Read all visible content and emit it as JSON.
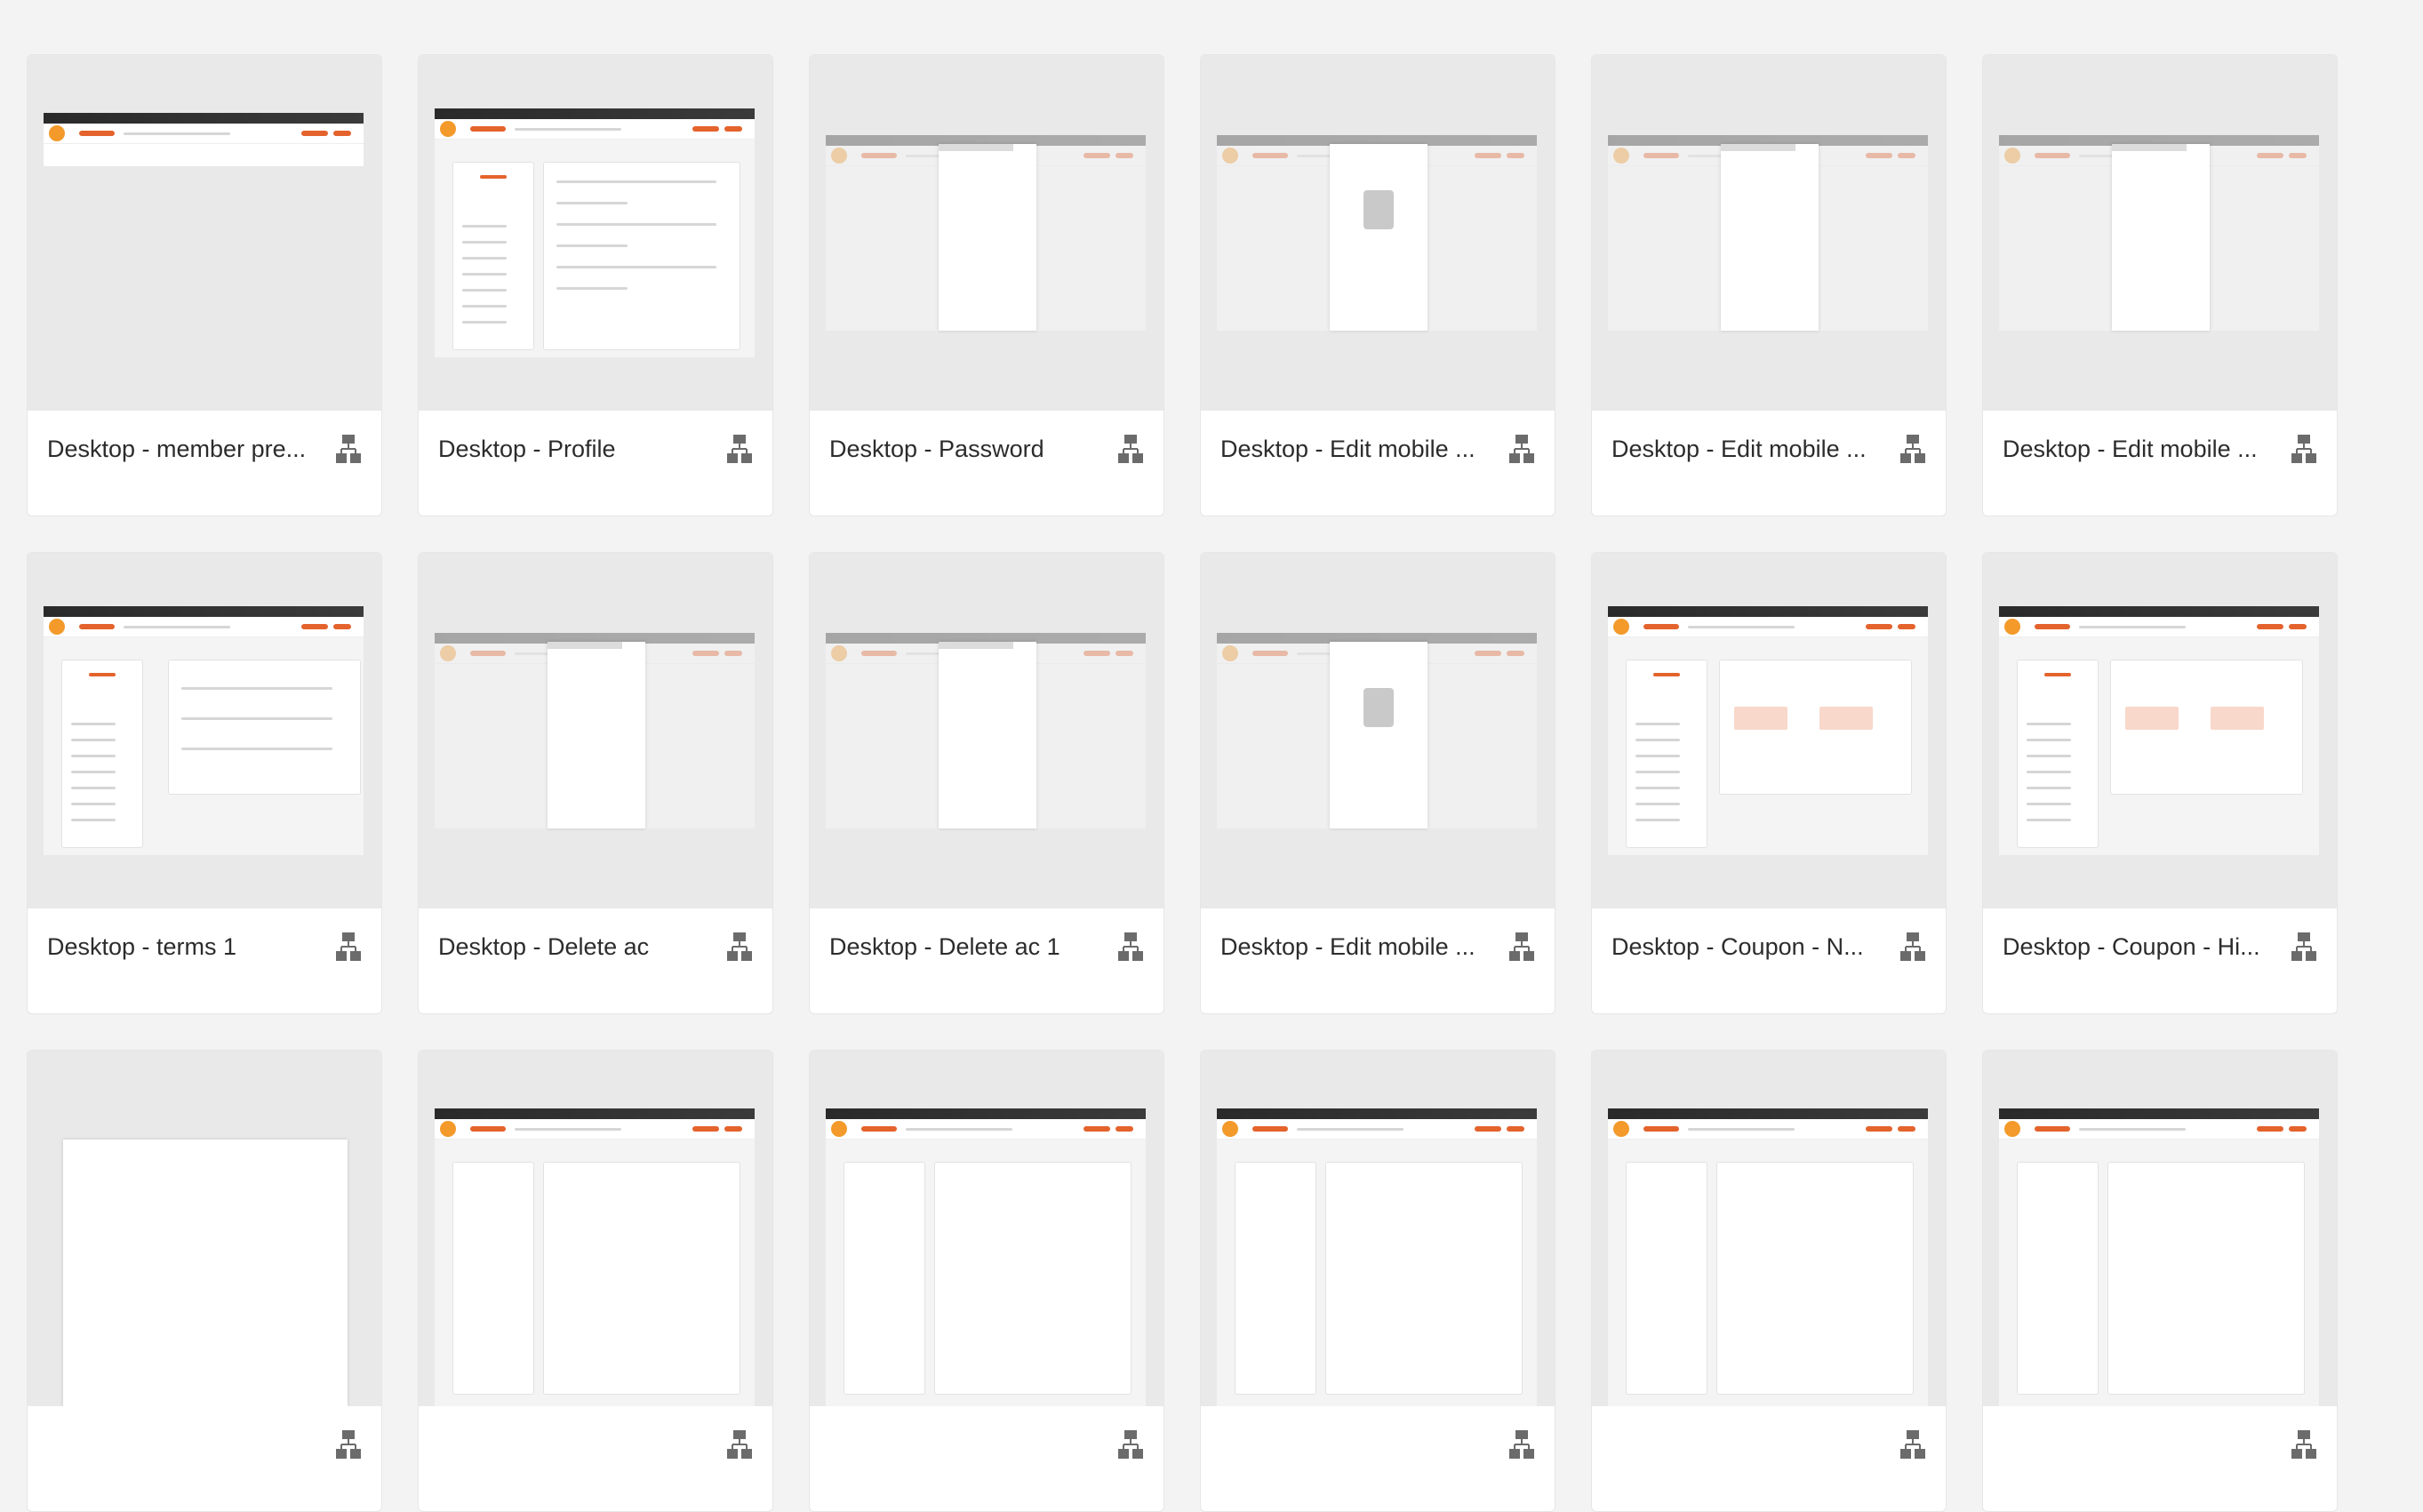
{
  "cards": [
    {
      "title": "Desktop - member pre..."
    },
    {
      "title": "Desktop - Profile"
    },
    {
      "title": "Desktop - Password"
    },
    {
      "title": "Desktop - Edit mobile ..."
    },
    {
      "title": "Desktop - Edit mobile ..."
    },
    {
      "title": "Desktop - Edit mobile ..."
    },
    {
      "title": "Desktop - terms 1"
    },
    {
      "title": "Desktop - Delete ac"
    },
    {
      "title": "Desktop - Delete ac 1"
    },
    {
      "title": "Desktop - Edit mobile ..."
    },
    {
      "title": "Desktop - Coupon - N..."
    },
    {
      "title": "Desktop - Coupon - Hi..."
    },
    {
      "title": ""
    },
    {
      "title": ""
    },
    {
      "title": ""
    },
    {
      "title": ""
    },
    {
      "title": ""
    },
    {
      "title": ""
    }
  ],
  "colors": {
    "accent": "#e4632d",
    "background": "#f3f3f3",
    "thumb_bg": "#e9e9e9"
  },
  "icons": {
    "card_icon": "prototype-flow-icon"
  }
}
